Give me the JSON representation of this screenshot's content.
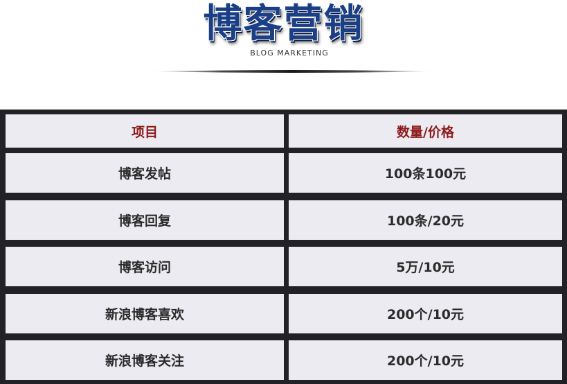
{
  "header": {
    "title": "博客营销",
    "subtitle": "BLOG MARKETING"
  },
  "table": {
    "columns": [
      "项目",
      "数量/价格"
    ],
    "rows": [
      {
        "item": "博客发帖",
        "price": "100条100元"
      },
      {
        "item": "博客回复",
        "price": "100条/20元"
      },
      {
        "item": "博客访问",
        "price": "5万/10元"
      },
      {
        "item": "新浪博客喜欢",
        "price": "200个/10元"
      },
      {
        "item": "新浪博客关注",
        "price": "200个/10元"
      }
    ]
  },
  "colors": {
    "title_blue": "#1b3f86",
    "header_red": "#8c1b1b",
    "grid_dark": "#222226",
    "cell_bg": "#ebebf1"
  }
}
